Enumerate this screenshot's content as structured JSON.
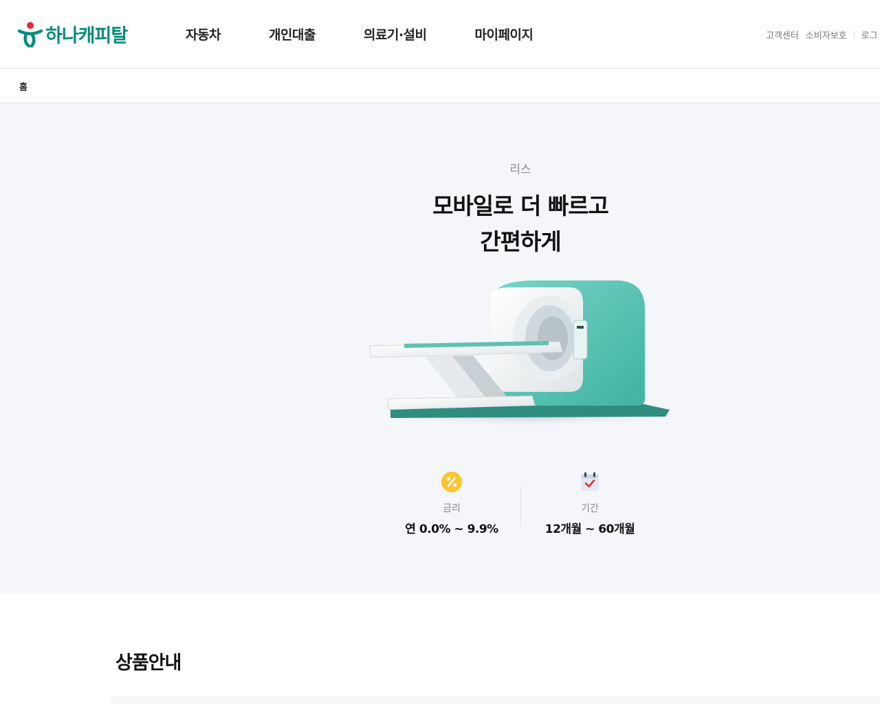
{
  "header": {
    "logo_text": "하나캐피탈",
    "nav": [
      "자동차",
      "개인대출",
      "의료기·설비",
      "마이페이지"
    ],
    "util": [
      "고객센터",
      "소비자보호",
      "로그"
    ]
  },
  "breadcrumb": {
    "home": "홈"
  },
  "hero": {
    "eyebrow": "리스",
    "title_line1": "모바일로 더 빠르고",
    "title_line2": "간편하게",
    "stats": [
      {
        "icon": "percent-coin-icon",
        "label": "금리",
        "value": "연 0.0% ~ 9.9%"
      },
      {
        "icon": "calendar-check-icon",
        "label": "기간",
        "value": "12개월 ~ 60개월"
      }
    ]
  },
  "section": {
    "title": "상품안내"
  },
  "colors": {
    "brand": "#008c7a",
    "hero_bg": "#f4f6f9",
    "accent_red": "#e5283a"
  }
}
